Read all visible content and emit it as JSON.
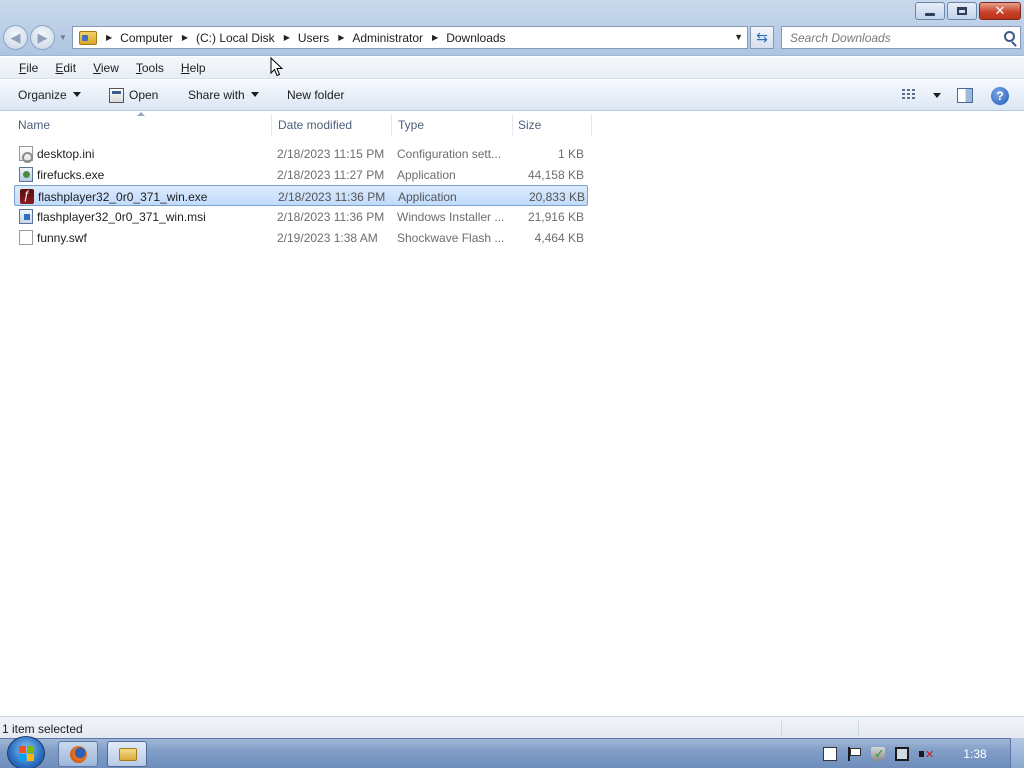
{
  "window": {
    "minimize_glyph": "minimize-icon",
    "maximize_glyph": "restore-icon",
    "close_glyph": "✕"
  },
  "address": {
    "breadcrumbs": [
      "Computer",
      "(C:) Local Disk",
      "Users",
      "Administrator",
      "Downloads"
    ]
  },
  "search": {
    "placeholder": "Search Downloads"
  },
  "menu": {
    "items": [
      {
        "label_u": "F",
        "label_rest": "ile"
      },
      {
        "label_u": "E",
        "label_rest": "dit"
      },
      {
        "label_u": "V",
        "label_rest": "iew"
      },
      {
        "label_u": "T",
        "label_rest": "ools"
      },
      {
        "label_u": "H",
        "label_rest": "elp"
      }
    ]
  },
  "toolbar": {
    "organize": "Organize",
    "open": "Open",
    "share_with": "Share with",
    "new_folder": "New folder"
  },
  "columns": {
    "name": "Name",
    "date_modified": "Date modified",
    "type": "Type",
    "size": "Size"
  },
  "files": [
    {
      "name": "desktop.ini",
      "date": "2/18/2023 11:15 PM",
      "type": "Configuration sett...",
      "size": "1 KB",
      "icon": "settings-file-icon",
      "selected": false
    },
    {
      "name": "firefucks.exe",
      "date": "2/18/2023 11:27 PM",
      "type": "Application",
      "size": "44,158 KB",
      "icon": "application-icon",
      "selected": false
    },
    {
      "name": "flashplayer32_0r0_371_win.exe",
      "date": "2/18/2023 11:36 PM",
      "type": "Application",
      "size": "20,833 KB",
      "icon": "flash-player-icon",
      "selected": true
    },
    {
      "name": "flashplayer32_0r0_371_win.msi",
      "date": "2/18/2023 11:36 PM",
      "type": "Windows Installer ...",
      "size": "21,916 KB",
      "icon": "installer-icon",
      "selected": false
    },
    {
      "name": "funny.swf",
      "date": "2/19/2023 1:38 AM",
      "type": "Shockwave Flash ...",
      "size": "4,464 KB",
      "icon": "blank-file-icon",
      "selected": false
    }
  ],
  "status": {
    "text": "1 item selected"
  },
  "taskbar": {
    "clock": "1:38",
    "pinned": [
      "firefox-icon",
      "explorer-folder-icon"
    ],
    "tray": [
      "action-center-icon",
      "flag-icon",
      "security-shield-icon",
      "network-icon",
      "volume-muted-icon"
    ]
  },
  "colors": {
    "selection": "#c1dbfc",
    "selection_border": "#7da2ce",
    "header_text": "#4c607a",
    "taskbar": "#7f9cc6"
  }
}
